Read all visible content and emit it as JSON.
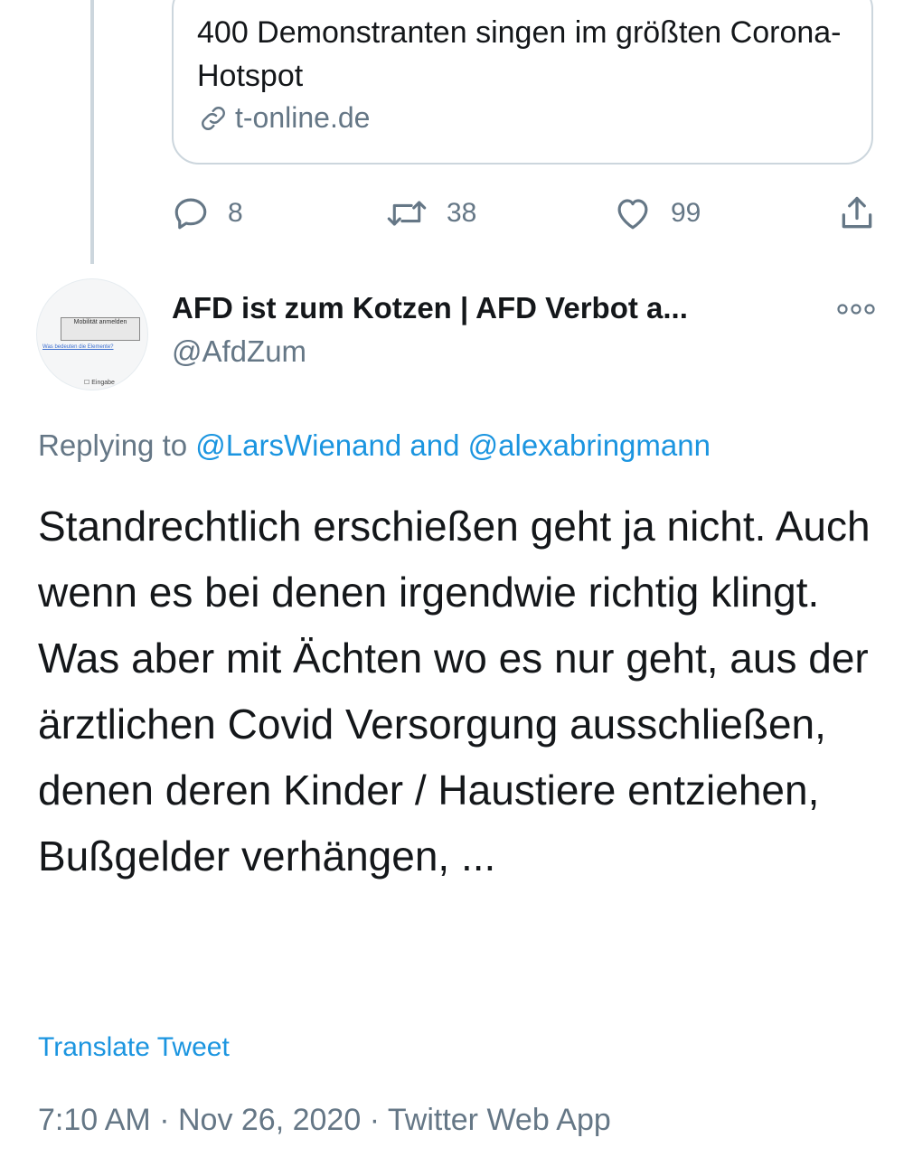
{
  "quoted_card": {
    "title": "400 Demonstranten singen im größten Corona-Hotspot",
    "domain": "t-online.de",
    "link_icon": "link-icon"
  },
  "actions": {
    "reply_count": "8",
    "retweet_count": "38",
    "like_count": "99",
    "icons": [
      "reply-icon",
      "retweet-icon",
      "like-icon",
      "share-icon"
    ]
  },
  "tweet": {
    "author_name": "AFD ist zum Kotzen | AFD Verbot a...",
    "author_handle": "@AfdZum",
    "avatar": {
      "button_text": "Mobilität anmelden",
      "link_text": "Was bedeuten die Elemente?",
      "checkbox_text": "Eingabe"
    },
    "replying_prefix": "Replying to",
    "replying_user1": "@LarsWienand",
    "replying_and": "and",
    "replying_user2": "@alexabringmann",
    "text": "Standrechtlich erschießen geht ja nicht. Auch wenn es bei denen irgendwie richtig klingt. Was aber mit Ächten wo es nur geht, aus der ärztlichen Covid Versorgung ausschließen, denen deren Kinder / Haustiere entziehen, Bußgelder verhängen, ...",
    "translate_label": "Translate Tweet",
    "time": "7:10 AM",
    "date": "Nov 26, 2020",
    "source": "Twitter Web App",
    "separator": "·"
  },
  "colors": {
    "text": "#14171a",
    "secondary": "#657786",
    "link": "#1b95e0",
    "border": "#ccd6dd"
  }
}
